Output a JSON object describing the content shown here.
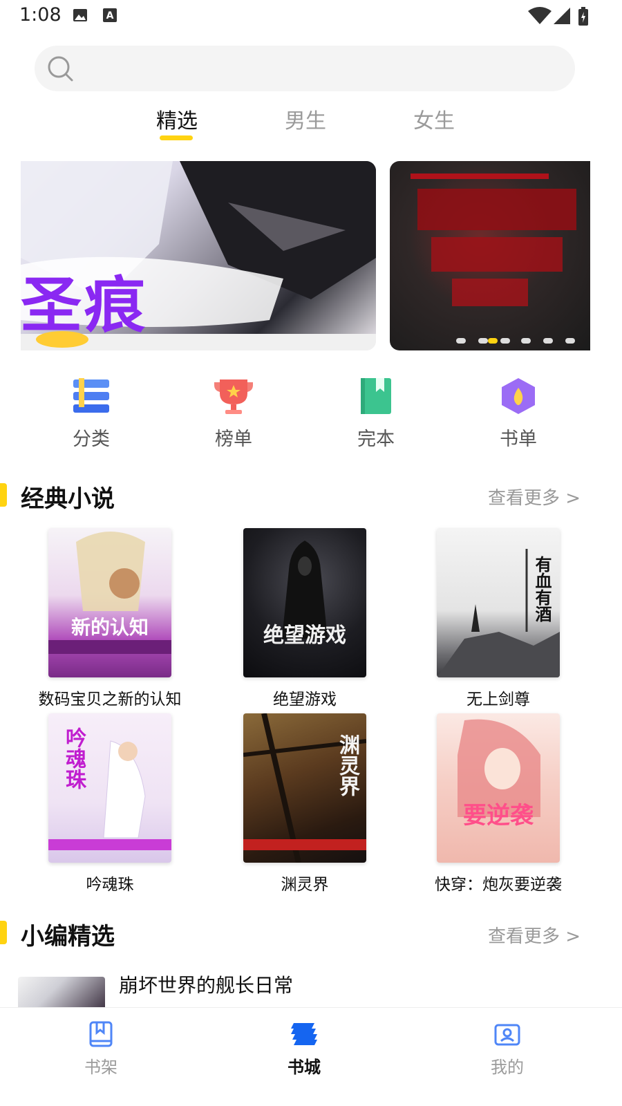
{
  "status_bar": {
    "time": "1:08",
    "left_icons": [
      "image-icon",
      "a-icon"
    ],
    "right_icons": [
      "wifi-icon",
      "signal-icon",
      "battery-icon"
    ]
  },
  "search": {
    "placeholder": ""
  },
  "tabs": [
    {
      "label": "精选",
      "active": true
    },
    {
      "label": "男生",
      "active": false
    },
    {
      "label": "女生",
      "active": false
    }
  ],
  "banner": {
    "slide_count": 6,
    "active_index": 1,
    "slides": [
      {
        "art_text": "圣痕"
      },
      {
        "art_text": ""
      }
    ]
  },
  "categories": [
    {
      "label": "分类",
      "icon": "category-list-icon"
    },
    {
      "label": "榜单",
      "icon": "trophy-icon"
    },
    {
      "label": "完本",
      "icon": "book-complete-icon"
    },
    {
      "label": "书单",
      "icon": "booklist-hexagon-icon"
    }
  ],
  "classic_section": {
    "title": "经典小说",
    "more": "查看更多 >",
    "books": [
      {
        "title": "数码宝贝之新的认知",
        "cover_text": "新的认知"
      },
      {
        "title": "绝望游戏",
        "cover_text": "绝望游戏"
      },
      {
        "title": "无上剑尊",
        "cover_text": "有血有酒"
      },
      {
        "title": "吟魂珠",
        "cover_text": "吟魂珠"
      },
      {
        "title": "渊灵界",
        "cover_text": "渊灵界"
      },
      {
        "title": "快穿：炮灰要逆袭",
        "cover_text": "要逆袭"
      }
    ]
  },
  "editor_section": {
    "title": "小编精选",
    "more": "查看更多 >",
    "items": [
      {
        "title": "崩坏世界的舰长日常"
      }
    ]
  },
  "bottom_nav": [
    {
      "label": "书架",
      "icon": "bookshelf-icon",
      "active": false
    },
    {
      "label": "书城",
      "icon": "bookstore-icon",
      "active": true
    },
    {
      "label": "我的",
      "icon": "profile-icon",
      "active": false
    }
  ],
  "colors": {
    "accent": "#ffd311",
    "inactive_text": "#9a9a9a",
    "active_nav": "#1565f0",
    "inactive_nav_icon": "#4f86f7"
  }
}
